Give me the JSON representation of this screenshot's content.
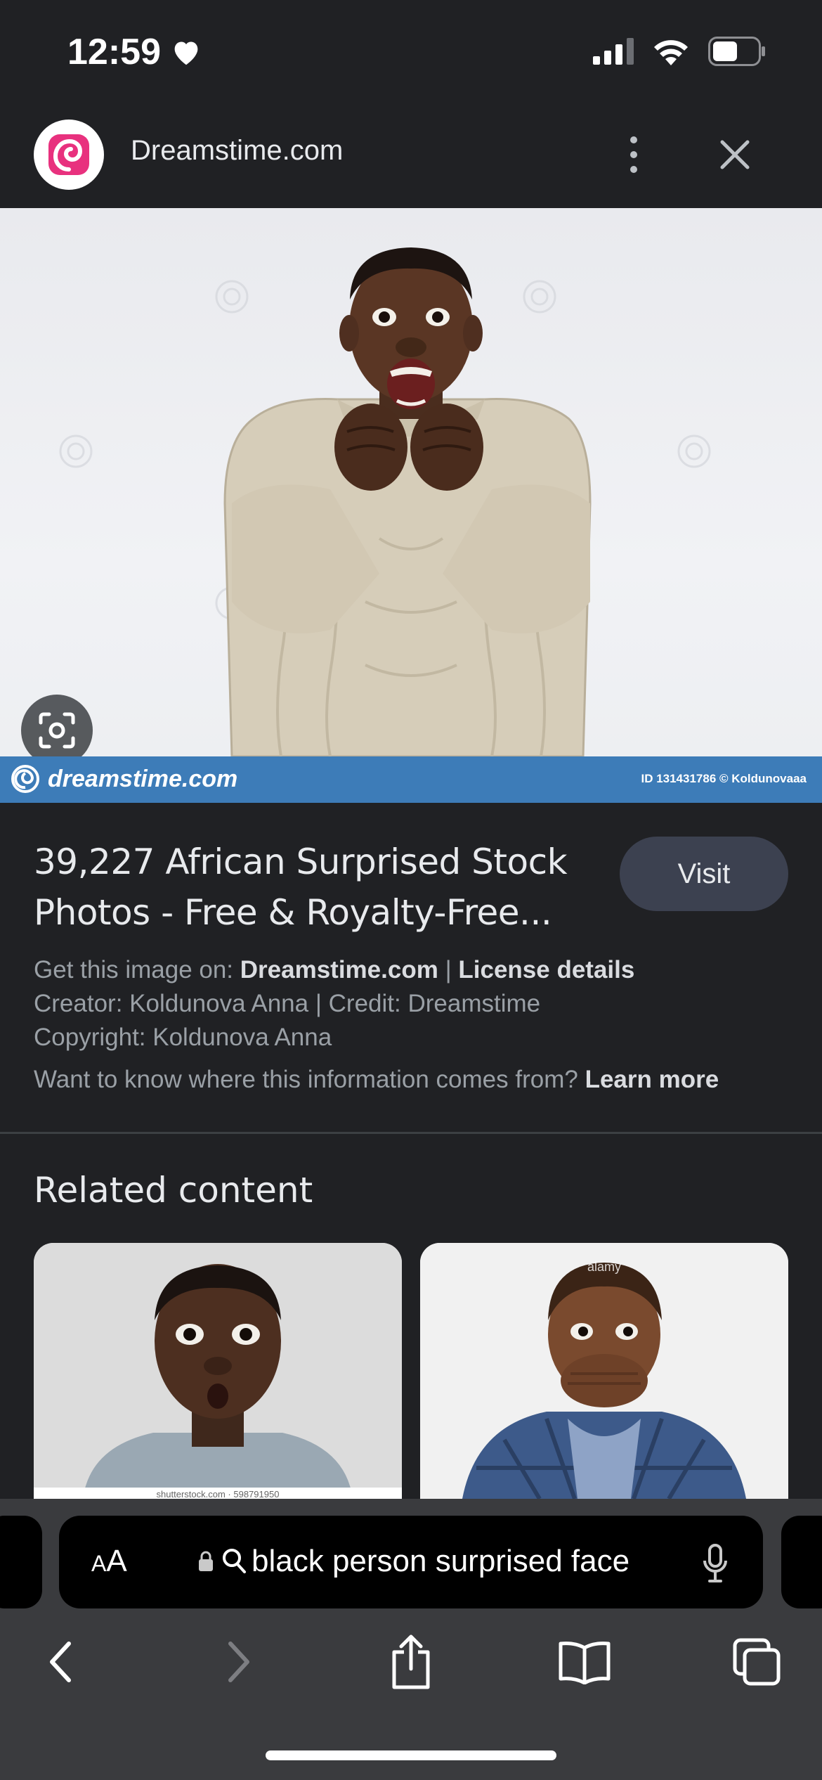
{
  "status_bar": {
    "time": "12:59"
  },
  "header": {
    "site_name": "Dreamstime.com"
  },
  "image": {
    "banner_brand": "dreamstime.com",
    "banner_id": "ID 131431786 © Koldunovaaa"
  },
  "result": {
    "title": "39,227 African Surprised Stock Photos - Free & Royalty-Free...",
    "visit_label": "Visit",
    "get_image_prefix": "Get this image on: ",
    "get_image_site": "Dreamstime.com",
    "separator": " | ",
    "license_link": "License details",
    "creator_line": "Creator: Koldunova Anna | Credit: Dreamstime",
    "copyright_line": "Copyright: Koldunova Anna",
    "info_question": "Want to know where this information comes from? ",
    "learn_more": "Learn more"
  },
  "related": {
    "title": "Related content",
    "thumb_one_watermark": "shutterstock.com · 598791950",
    "thumb_two_watermark": "alamy"
  },
  "address_bar": {
    "aa_label_small": "A",
    "aa_label_large": "A",
    "query": "black person surprised face"
  },
  "colors": {
    "background": "#202124",
    "banner_blue": "#3d7cb8",
    "visit_button": "#3c4150",
    "brand_pink": "#e8317e"
  }
}
